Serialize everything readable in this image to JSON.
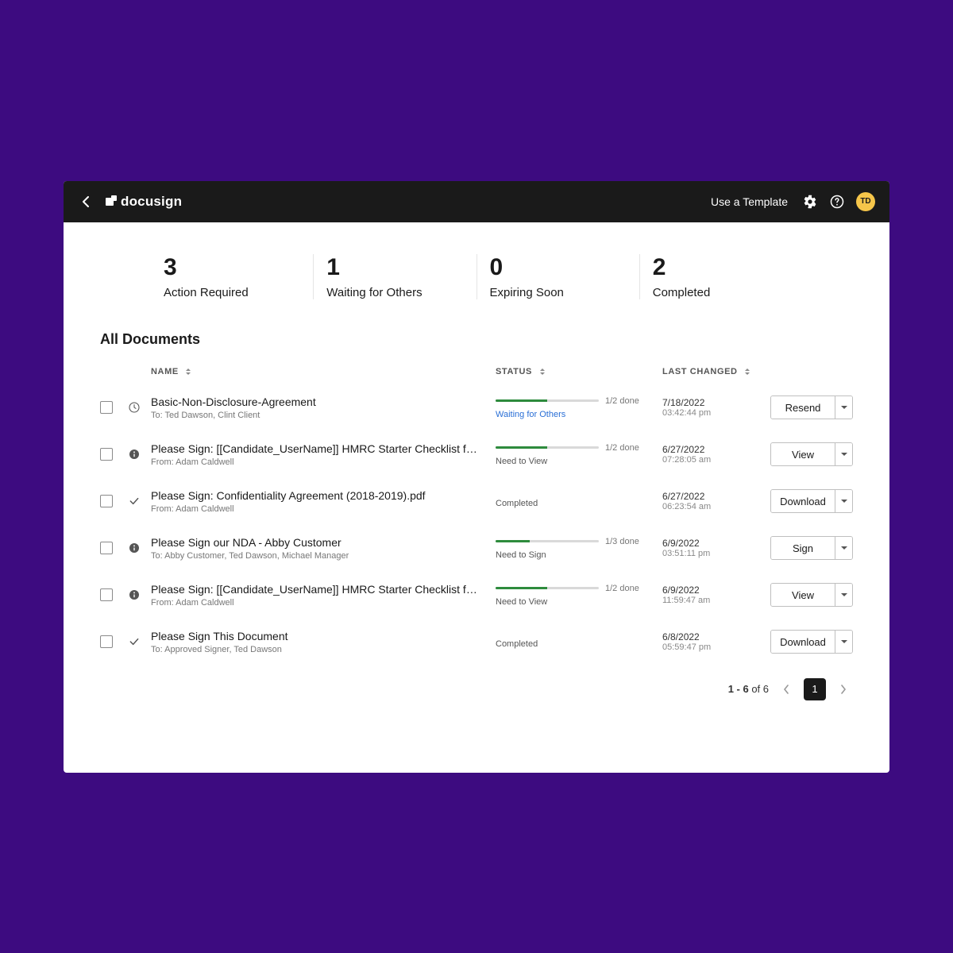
{
  "header": {
    "brand": "docusign",
    "template_link": "Use a Template",
    "avatar": "TD"
  },
  "summary": [
    {
      "count": "3",
      "label": "Action Required"
    },
    {
      "count": "1",
      "label": "Waiting for Others"
    },
    {
      "count": "0",
      "label": "Expiring Soon"
    },
    {
      "count": "2",
      "label": "Completed"
    }
  ],
  "section_title": "All Documents",
  "columns": {
    "name": "NAME",
    "status": "STATUS",
    "last_changed": "LAST CHANGED"
  },
  "rows": [
    {
      "icon": "clock",
      "title": "Basic-Non-Disclosure-Agreement",
      "sub": "To: Ted Dawson, Clint Client",
      "progress_pct": 50,
      "progress_text": "1/2 done",
      "status": "Waiting for Others",
      "status_blue": true,
      "date": "7/18/2022",
      "time": "03:42:44 pm",
      "action": "Resend"
    },
    {
      "icon": "info",
      "title": "Please Sign: [[Candidate_UserName]] HMRC Starter Checklist for PAYE Workers",
      "sub": "From: Adam Caldwell",
      "progress_pct": 50,
      "progress_text": "1/2 done",
      "status": "Need to View",
      "status_blue": false,
      "date": "6/27/2022",
      "time": "07:28:05 am",
      "action": "View"
    },
    {
      "icon": "check",
      "title": "Please Sign: Confidentiality Agreement (2018-2019).pdf",
      "sub": "From: Adam Caldwell",
      "progress_pct": null,
      "progress_text": "",
      "status": "Completed",
      "status_blue": false,
      "date": "6/27/2022",
      "time": "06:23:54 am",
      "action": "Download"
    },
    {
      "icon": "info",
      "title": "Please Sign our NDA - Abby Customer",
      "sub": "To: Abby Customer, Ted Dawson, Michael Manager",
      "progress_pct": 33,
      "progress_text": "1/3 done",
      "status": "Need to Sign",
      "status_blue": false,
      "date": "6/9/2022",
      "time": "03:51:11 pm",
      "action": "Sign"
    },
    {
      "icon": "info",
      "title": "Please Sign: [[Candidate_UserName]] HMRC Starter Checklist for PAYE Workers",
      "sub": "From: Adam Caldwell",
      "progress_pct": 50,
      "progress_text": "1/2 done",
      "status": "Need to View",
      "status_blue": false,
      "date": "6/9/2022",
      "time": "11:59:47 am",
      "action": "View"
    },
    {
      "icon": "check",
      "title": "Please Sign This Document",
      "sub": "To: Approved Signer, Ted Dawson",
      "progress_pct": null,
      "progress_text": "",
      "status": "Completed",
      "status_blue": false,
      "date": "6/8/2022",
      "time": "05:59:47 pm",
      "action": "Download"
    }
  ],
  "pagination": {
    "range": "1 - 6",
    "of_label": " of 6",
    "current": "1"
  }
}
